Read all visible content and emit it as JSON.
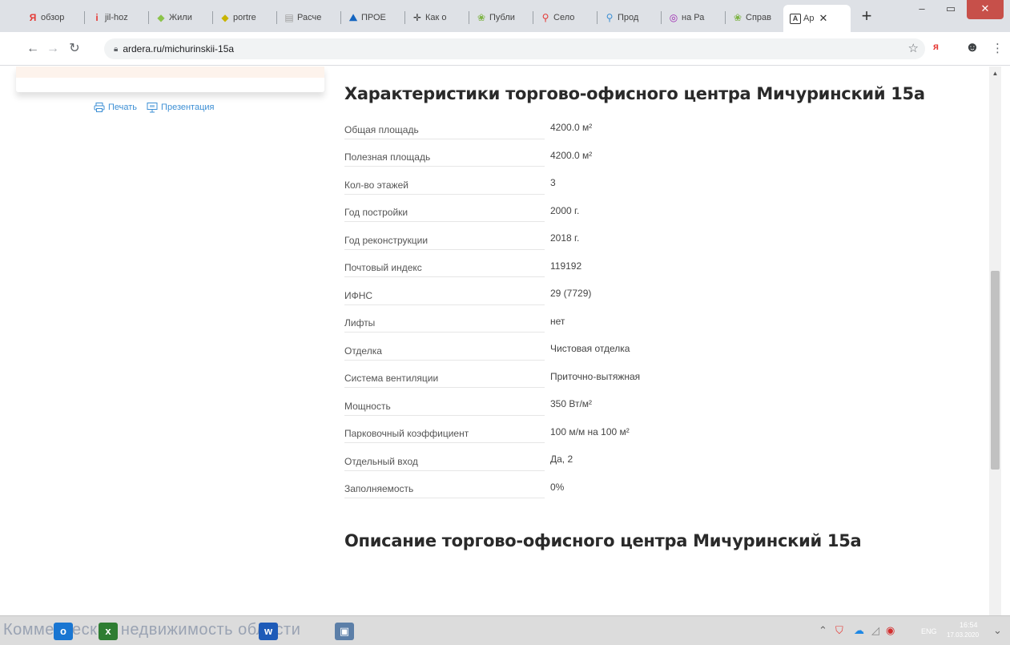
{
  "browser": {
    "tabs": [
      {
        "label": "обзор",
        "icon": "yandex-icon",
        "color": "#e53935"
      },
      {
        "label": "jil-hoz",
        "icon": "info-icon",
        "color": "#e53935"
      },
      {
        "label": "Жили",
        "icon": "leaf-icon",
        "color": "#8bc34a"
      },
      {
        "label": "portre",
        "icon": "leaf-icon",
        "color": "#c8b400"
      },
      {
        "label": "Расче",
        "icon": "document-icon",
        "color": "#9e9e9e"
      },
      {
        "label": "ПРОЕ",
        "icon": "mountain-icon",
        "color": "#1565c0"
      },
      {
        "label": "Как о",
        "icon": "plus-icon",
        "color": "#333333"
      },
      {
        "label": "Публи",
        "icon": "sprout-icon",
        "color": "#7cb342"
      },
      {
        "label": "Село",
        "icon": "map-pin-icon",
        "color": "#e53935"
      },
      {
        "label": "Прод",
        "icon": "map-pin-icon",
        "color": "#3d8fd4"
      },
      {
        "label": "на Ра",
        "icon": "globe-icon",
        "color": "#9c27b0"
      },
      {
        "label": "Справ",
        "icon": "sprout-icon",
        "color": "#7cb342"
      }
    ],
    "active_tab": {
      "label": "Ар",
      "icon": "ardera-icon"
    },
    "url": "ardera.ru/michurinskii-15a"
  },
  "sidebar": {
    "print_label": "Печать",
    "presentation_label": "Презентация"
  },
  "main": {
    "specs_title": "Характеристики торгово-офисного центра Мичуринский 15а",
    "specs": [
      {
        "label": "Общая площадь",
        "value": "4200.0 м²"
      },
      {
        "label": "Полезная площадь",
        "value": "4200.0 м²"
      },
      {
        "label": "Кол-во этажей",
        "value": "3"
      },
      {
        "label": "Год постройки",
        "value": "2000 г."
      },
      {
        "label": "Год реконструкции",
        "value": "2018 г."
      },
      {
        "label": "Почтовый индекс",
        "value": "119192"
      },
      {
        "label": "ИФНС",
        "value": "29 (7729)"
      },
      {
        "label": "Лифты",
        "value": "нет"
      },
      {
        "label": "Отделка",
        "value": "Чистовая отделка"
      },
      {
        "label": "Система вентиляции",
        "value": "Приточно-вытяжная"
      },
      {
        "label": "Мощность",
        "value": "350 Вт/м²"
      },
      {
        "label": "Парковочный коэффициент",
        "value": "100 м/м на 100 м²"
      },
      {
        "label": "Отдельный вход",
        "value": "Да, 2"
      },
      {
        "label": "Заполняемость",
        "value": "0%"
      }
    ],
    "description_title": "Описание торгово-офисного центра Мичуринский 15а"
  },
  "taskbar": {
    "background_text": "Коммерческая недвижимость области",
    "apps": [
      {
        "letter": "o",
        "name": "outlook",
        "color": "#1976d2"
      },
      {
        "letter": "x",
        "name": "excel",
        "color": "#2e7d32"
      },
      {
        "letter": "w",
        "name": "word",
        "color": "#1e5bb8"
      }
    ],
    "lang": "ENG",
    "time": "16:54",
    "date": "17.03.2020"
  },
  "colors": {
    "link": "#3d8fd4",
    "window_close": "#c7504a"
  }
}
